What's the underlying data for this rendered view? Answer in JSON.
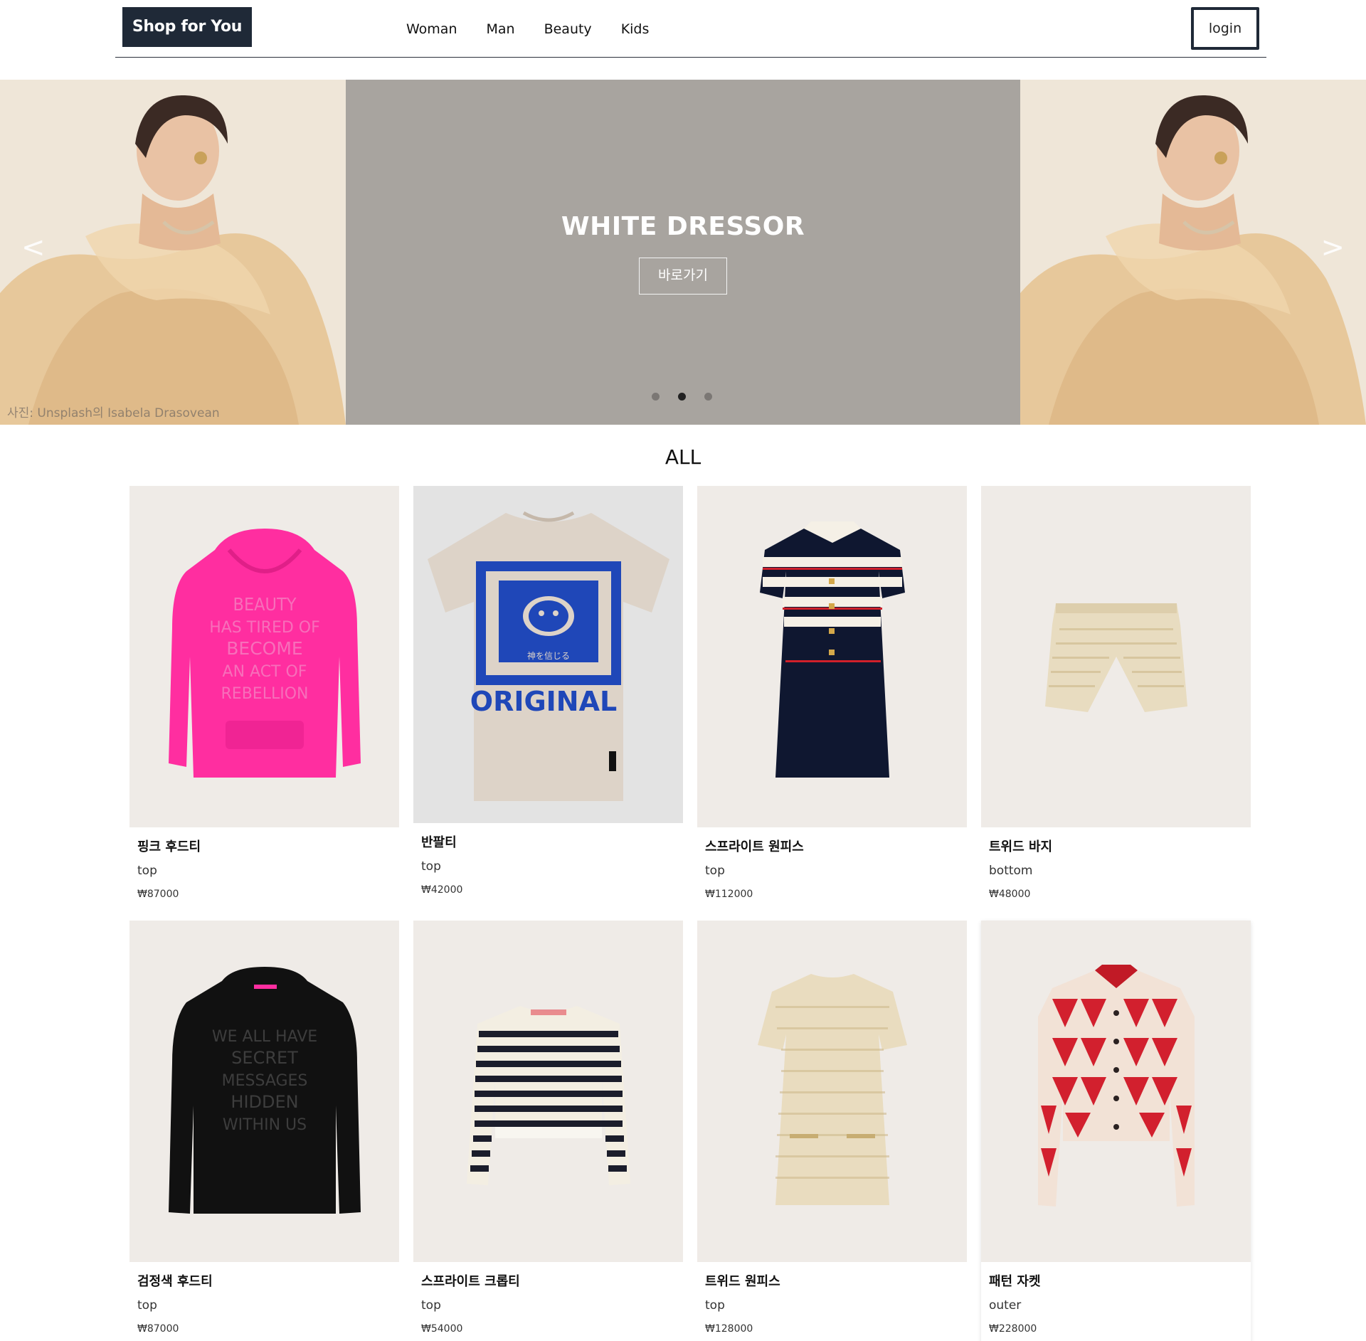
{
  "header": {
    "logo": "Shop for You",
    "nav": [
      "Woman",
      "Man",
      "Beauty",
      "Kids"
    ],
    "login": "login"
  },
  "hero": {
    "title": "WHITE DRESSOR",
    "button": "바로가기",
    "photo_credit": "사진: Unsplash의 Isabela Drasovean",
    "prev_arrow": "<",
    "next_arrow": ">",
    "slides_total": 3,
    "active_slide": 2,
    "center_bg": "#a8a49f"
  },
  "section": {
    "title": "ALL"
  },
  "products": [
    {
      "name": "핑크 후드티",
      "category": "top",
      "price": "₩87000",
      "icon": "pink-hoodie"
    },
    {
      "name": "반팔티",
      "category": "top",
      "price": "₩42000",
      "icon": "graphic-tshirt"
    },
    {
      "name": "스프라이트 원피스",
      "category": "top",
      "price": "₩112000",
      "icon": "striped-dress"
    },
    {
      "name": "트위드 바지",
      "category": "bottom",
      "price": "₩48000",
      "icon": "tweed-shorts"
    },
    {
      "name": "검정색 후드티",
      "category": "top",
      "price": "₩87000",
      "icon": "black-hoodie"
    },
    {
      "name": "스프라이트 크롭티",
      "category": "top",
      "price": "₩54000",
      "icon": "striped-crop-sweater"
    },
    {
      "name": "트위드 원피스",
      "category": "top",
      "price": "₩128000",
      "icon": "tweed-dress"
    },
    {
      "name": "패턴 자켓",
      "category": "outer",
      "price": "₩228000",
      "icon": "pattern-jacket"
    }
  ],
  "product_art": {
    "pink_hoodie_text": [
      "BEAUTY",
      "HAS TIRED OF",
      "BECOME",
      "AN ACT OF",
      "REBELLION"
    ],
    "tshirt_text": "ORIGINAL",
    "tshirt_sub": "神を信じる",
    "black_hoodie_text": [
      "WE ALL HAVE",
      "SECRET",
      "MESSAGES",
      "HIDDEN",
      "WITHIN US"
    ]
  },
  "colors": {
    "brand_dark": "#1f2937",
    "card_bg": "#efebe7",
    "pink": "#ff2ea0",
    "blue_print": "#1f47b8"
  }
}
